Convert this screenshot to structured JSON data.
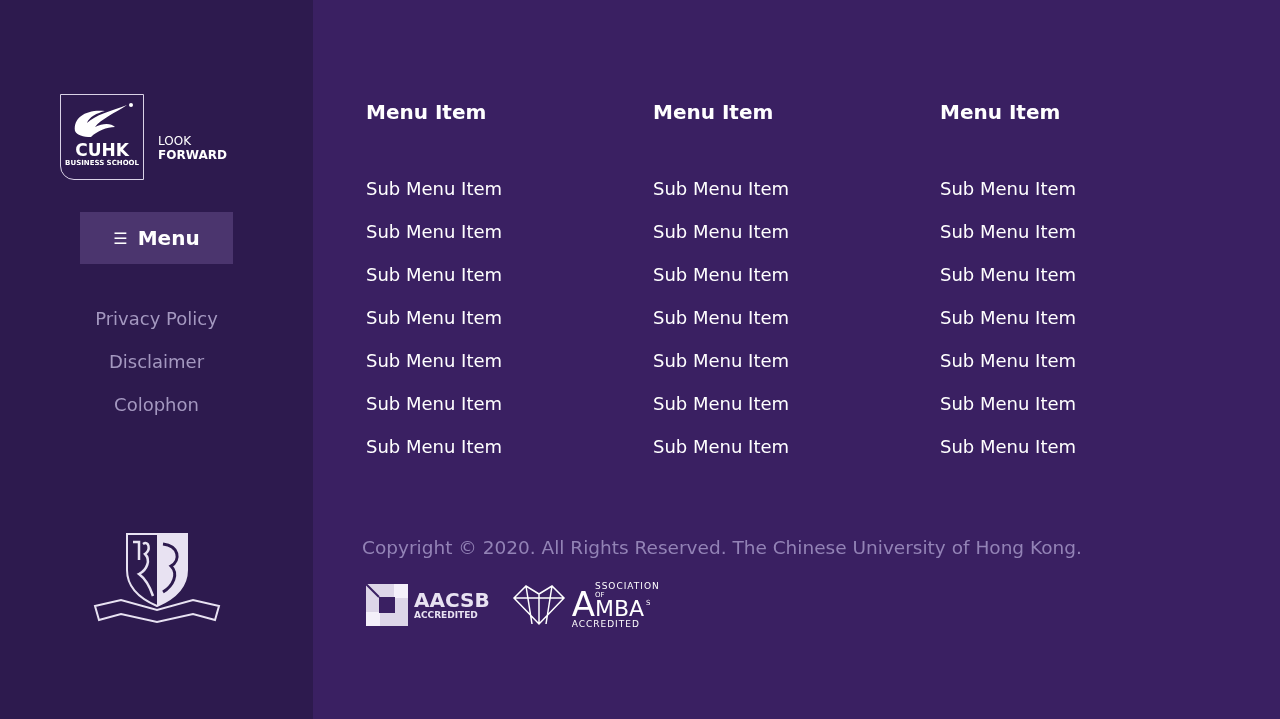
{
  "logo": {
    "name": "CUHK",
    "subtitle": "BUSINESS SCHOOL",
    "tagline_top": "LOOK",
    "tagline_bottom": "FORWARD"
  },
  "menu_button": {
    "icon": "☰",
    "label": "Menu"
  },
  "sidebar_links": [
    "Privacy Policy",
    "Disclaimer",
    "Colophon"
  ],
  "columns": [
    {
      "heading": "Menu Item",
      "items": [
        "Sub Menu Item",
        "Sub Menu Item",
        "Sub Menu Item",
        "Sub Menu Item",
        "Sub Menu Item",
        "Sub Menu Item",
        "Sub Menu Item"
      ]
    },
    {
      "heading": "Menu Item",
      "items": [
        "Sub Menu Item",
        "Sub Menu Item",
        "Sub Menu Item",
        "Sub Menu Item",
        "Sub Menu Item",
        "Sub Menu Item",
        "Sub Menu Item"
      ]
    },
    {
      "heading": "Menu Item",
      "items": [
        "Sub Menu Item",
        "Sub Menu Item",
        "Sub Menu Item",
        "Sub Menu Item",
        "Sub Menu Item",
        "Sub Menu Item",
        "Sub Menu Item"
      ]
    }
  ],
  "copyright": "Copyright © 2020. All Rights Reserved. The Chinese University of Hong Kong.",
  "accreditations": [
    {
      "kind": "aacsb",
      "name": "AACSB",
      "label": "ACCREDITED"
    },
    {
      "kind": "amba",
      "initial": "A",
      "top": "SSOCIATION",
      "of": "OF",
      "name": "MBA",
      "suffix": "S",
      "label": "ACCREDITED"
    }
  ]
}
